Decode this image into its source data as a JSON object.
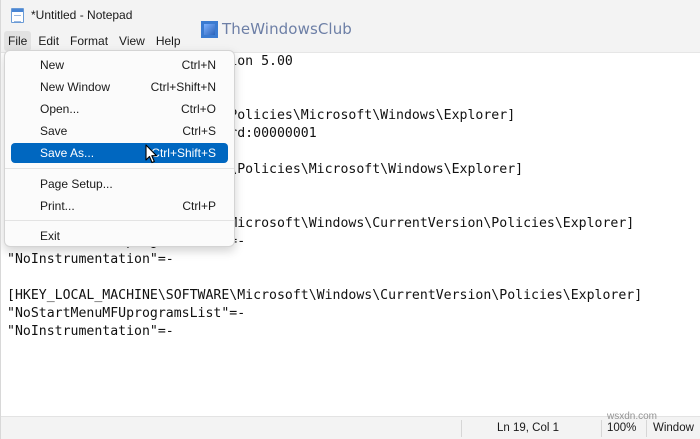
{
  "window": {
    "title": "*Untitled - Notepad"
  },
  "watermark_top": {
    "text": "TheWindowsClub"
  },
  "menubar": {
    "items": [
      "File",
      "Edit",
      "Format",
      "View",
      "Help"
    ],
    "active": "File"
  },
  "file_menu": {
    "items": [
      {
        "label": "New",
        "shortcut": "Ctrl+N"
      },
      {
        "label": "New Window",
        "shortcut": "Ctrl+Shift+N"
      },
      {
        "label": "Open...",
        "shortcut": "Ctrl+O"
      },
      {
        "label": "Save",
        "shortcut": "Ctrl+S"
      },
      {
        "label": "Save As...",
        "shortcut": "Ctrl+Shift+S"
      },
      {
        "label": "Page Setup...",
        "shortcut": ""
      },
      {
        "label": "Print...",
        "shortcut": "Ctrl+P"
      },
      {
        "label": "Exit",
        "shortcut": ""
      }
    ],
    "highlighted": "Save As..."
  },
  "editor": {
    "lines": [
      "Windows Registry Editor Version 5.00",
      "",
      "",
      "[HKEY_CURRENT_USER\\Software\\Policies\\Microsoft\\Windows\\Explorer]",
      "\"ShowOrHideMostUsedApps\"=dword:00000001",
      "",
      "[HKEY_LOCAL_MACHINE\\SOFTWARE\\Policies\\Microsoft\\Windows\\Explorer]",
      "",
      "",
      "[HKEY_CURRENT_USER\\Software\\Microsoft\\Windows\\CurrentVersion\\Policies\\Explorer]",
      "\"NoStartMenuMFUprogramsList\"=-",
      "\"NoInstrumentation\"=-",
      "",
      "[HKEY_LOCAL_MACHINE\\SOFTWARE\\Microsoft\\Windows\\CurrentVersion\\Policies\\Explorer]",
      "\"NoStartMenuMFUprogramsList\"=-",
      "\"NoInstrumentation\"=-"
    ]
  },
  "statusbar": {
    "position": "Ln 19, Col 1",
    "zoom": "100%",
    "line_ending": "Window",
    "watermark": "wsxdn.com"
  },
  "colors": {
    "highlight": "#0067c0",
    "chrome": "#f3f3f3"
  }
}
